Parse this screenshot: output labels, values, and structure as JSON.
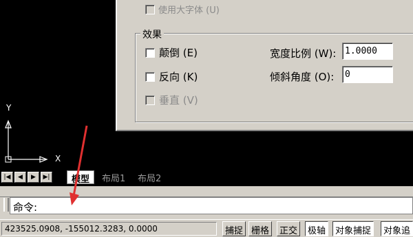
{
  "dialog": {
    "bigfont_checkbox_label": "使用大字体 (U)",
    "effects_group_title": "效果",
    "upside_down_label": "颠倒 (E)",
    "backwards_label": "反向 (K)",
    "vertical_label": "垂直 (V)",
    "width_factor_label": "宽度比例 (W):",
    "width_factor_value": "1.0000",
    "oblique_angle_label": "倾斜角度 (O):",
    "oblique_angle_value": "0"
  },
  "ucs": {
    "y_label": "Y",
    "x_label": "X"
  },
  "layout_tabs": [
    {
      "label": "模型",
      "active": true
    },
    {
      "label": "布局1",
      "active": false
    },
    {
      "label": "布局2",
      "active": false
    }
  ],
  "command_line": {
    "prompt": "命令:"
  },
  "status_bar": {
    "coordinates": "423525.0908,  -155012.3283,  0.0000",
    "buttons": [
      {
        "label": "捕捉",
        "on": false
      },
      {
        "label": "栅格",
        "on": false
      },
      {
        "label": "正交",
        "on": false
      },
      {
        "label": "极轴",
        "on": true
      },
      {
        "label": "对象捕捉",
        "on": true
      },
      {
        "label": "对象追",
        "on": true
      }
    ]
  },
  "annotation": {
    "arrow_color": "#e03030"
  }
}
